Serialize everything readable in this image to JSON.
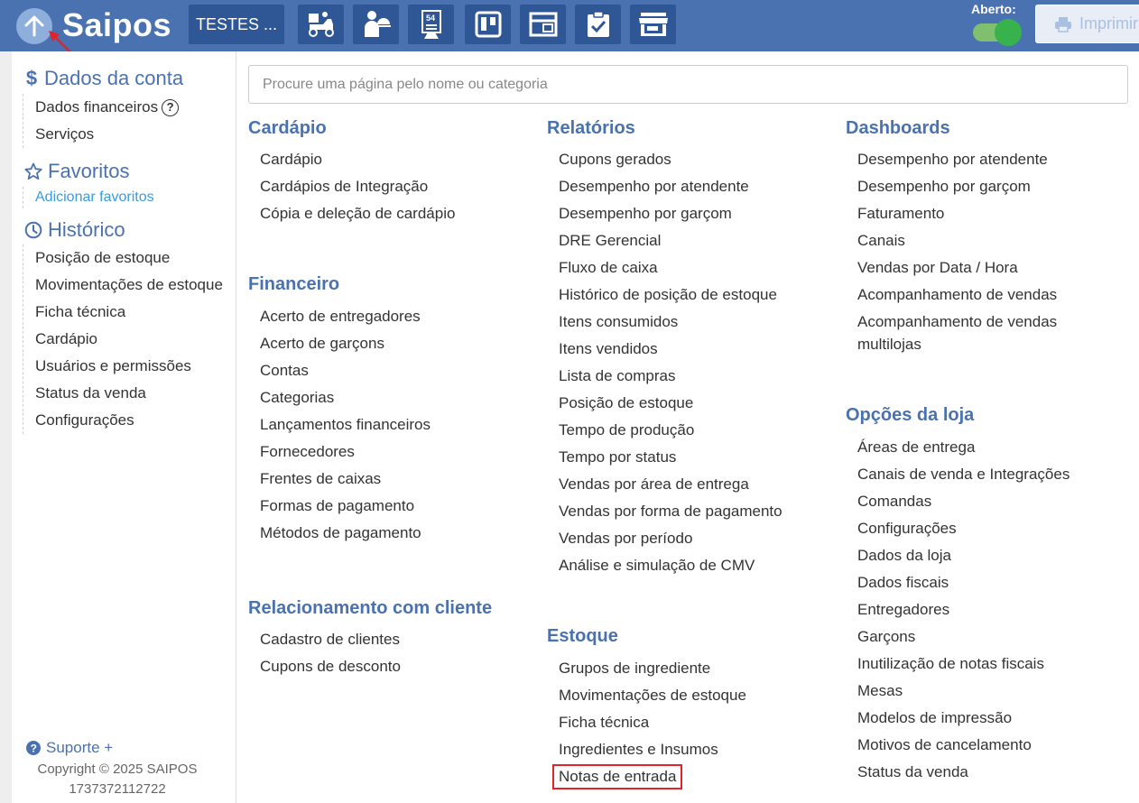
{
  "header": {
    "logo": "Saipos",
    "store_button": "TESTES ...",
    "open_label": "Aberto:",
    "print_button": "Imprimir",
    "toolbar_icons": [
      "delivery-icon",
      "waiter-icon",
      "order-ticket-icon",
      "board-icon",
      "kiosk-icon",
      "checklist-icon",
      "store-icon"
    ]
  },
  "sidebar": {
    "account": {
      "title": "Dados da conta",
      "items": [
        "Dados financeiros",
        "Serviços"
      ]
    },
    "favorites": {
      "title": "Favoritos",
      "add": "Adicionar favoritos"
    },
    "history": {
      "title": "Histórico",
      "items": [
        "Posição de estoque",
        "Movimentações de estoque",
        "Ficha técnica",
        "Cardápio",
        "Usuários e permissões",
        "Status da venda",
        "Configurações"
      ]
    },
    "support": "Suporte +",
    "copyright": "Copyright © 2025 SAIPOS",
    "build": "1737372112722"
  },
  "search": {
    "placeholder": "Procure uma página pelo nome ou categoria"
  },
  "categories": {
    "cardapio": {
      "title": "Cardápio",
      "links": [
        "Cardápio",
        "Cardápios de Integração",
        "Cópia e deleção de cardápio"
      ]
    },
    "financeiro": {
      "title": "Financeiro",
      "links": [
        "Acerto de entregadores",
        "Acerto de garçons",
        "Contas",
        "Categorias",
        "Lançamentos financeiros",
        "Fornecedores",
        "Frentes de caixas",
        "Formas de pagamento",
        "Métodos de pagamento"
      ]
    },
    "relacionamento": {
      "title": "Relacionamento com cliente",
      "links": [
        "Cadastro de clientes",
        "Cupons de desconto"
      ]
    },
    "relatorios": {
      "title": "Relatórios",
      "links": [
        "Cupons gerados",
        "Desempenho por atendente",
        "Desempenho por garçom",
        "DRE Gerencial",
        "Fluxo de caixa",
        "Histórico de posição de estoque",
        "Itens consumidos",
        "Itens vendidos",
        "Lista de compras",
        "Posição de estoque",
        "Tempo de produção",
        "Tempo por status",
        "Vendas por área de entrega",
        "Vendas por forma de pagamento",
        "Vendas por período",
        "Análise e simulação de CMV"
      ]
    },
    "estoque": {
      "title": "Estoque",
      "links": [
        "Grupos de ingrediente",
        "Movimentações de estoque",
        "Ficha técnica",
        "Ingredientes e Insumos",
        "Notas de entrada"
      ]
    },
    "dashboards": {
      "title": "Dashboards",
      "links": [
        "Desempenho por atendente",
        "Desempenho por garçom",
        "Faturamento",
        "Canais",
        "Vendas por Data / Hora",
        "Acompanhamento de vendas",
        "Acompanhamento de vendas multilojas"
      ]
    },
    "opcoes": {
      "title": "Opções da loja",
      "links": [
        "Áreas de entrega",
        "Canais de venda e Integrações",
        "Comandas",
        "Configurações",
        "Dados da loja",
        "Dados fiscais",
        "Entregadores",
        "Garçons",
        "Inutilização de notas fiscais",
        "Mesas",
        "Modelos de impressão",
        "Motivos de cancelamento",
        "Status da venda"
      ]
    }
  },
  "colors": {
    "header_bg": "#4a72b1",
    "header_button_bg": "#2f5796",
    "accent": "#4a72b1",
    "toggle_on": "#37b24d",
    "highlight": "#e0242a",
    "link_blue": "#3a9be0"
  }
}
